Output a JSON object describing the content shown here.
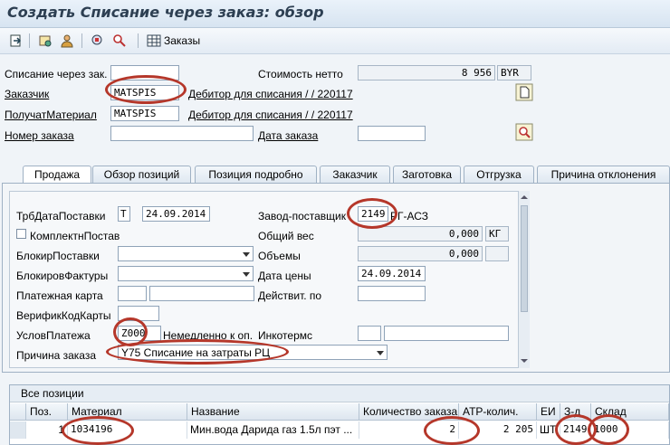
{
  "window": {
    "title": "Создать Списание через заказ: обзор"
  },
  "toolbar": {
    "orders_label": "Заказы"
  },
  "header": {
    "sales_doc_label": "Списание через зак...",
    "net_value_label": "Стоимость нетто",
    "net_value": "8 956",
    "currency": "BYR",
    "customer_label": "Заказчик",
    "customer_value": "MATSPIS",
    "customer_desc": "Дебитор для списания / / 220117",
    "recipient_label": "ПолучатМатериал",
    "recipient_value": "MATSPIS",
    "recipient_desc": "Дебитор для списания / / 220117",
    "po_number_label": "Номер заказа",
    "po_date_label": "Дата заказа"
  },
  "tabs": [
    {
      "label": "Продажа",
      "active": true
    },
    {
      "label": "Обзор позиций"
    },
    {
      "label": "Позиция подробно"
    },
    {
      "label": "Заказчик"
    },
    {
      "label": "Заготовка"
    },
    {
      "label": "Отгрузка"
    },
    {
      "label": "Причина отклонения"
    }
  ],
  "sales": {
    "req_delivery_label": "ТрбДатаПоставки",
    "req_delivery_type": "T",
    "req_delivery_date": "24.09.2014",
    "complete_delivery_label": "КомплектнПостав",
    "delivery_block_label": "БлокирПоставки",
    "billing_block_label": "БлокировФактуры",
    "payment_card_label": "Платежная карта",
    "card_verif_label": "ВерификКодКарты",
    "payment_terms_label": "УсловПлатежа",
    "payment_terms_value": "Z000",
    "payment_terms_desc": "Немедленно к оп...",
    "order_reason_label": "Причина заказа",
    "order_reason_value": "Y75 Списание на затраты РЦ",
    "plant_label": "Завод-поставщик",
    "plant_value": "2149",
    "plant_desc": "РГ-АСЗ",
    "total_weight_label": "Общий вес",
    "total_weight_value": "0,000",
    "weight_unit": "КГ",
    "volume_label": "Объемы",
    "volume_value": "0,000",
    "pricing_date_label": "Дата цены",
    "pricing_date_value": "24.09.2014",
    "valid_to_label": "Действит. по",
    "incoterms_label": "Инкотермс"
  },
  "items": {
    "section_title": "Все позиции",
    "columns": [
      "Поз.",
      "Материал",
      "Название",
      "Количество заказа",
      "АТР-колич.",
      "ЕИ",
      "З-д",
      "Склад"
    ],
    "rows": [
      {
        "pos": "1",
        "material": "1034196",
        "name": "Мин.вода Дарида газ 1.5л пэт ...",
        "qty": "2",
        "atp": "2 205",
        "uom": "ШТ",
        "plant": "2149",
        "sloc": "1000"
      }
    ]
  }
}
